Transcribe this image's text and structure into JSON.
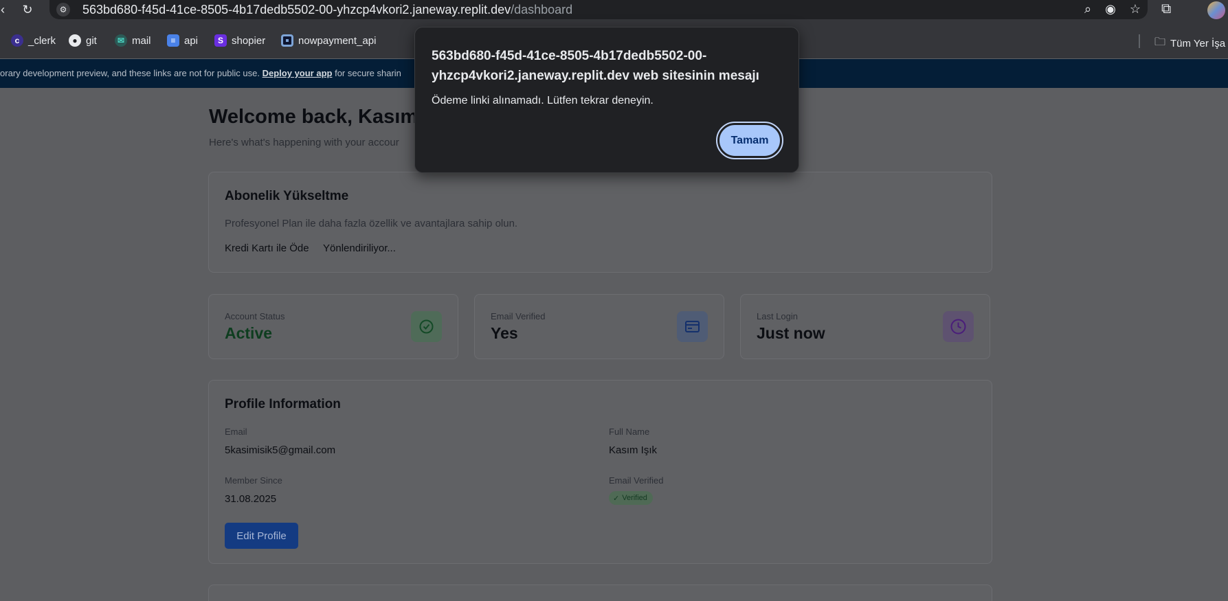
{
  "browser": {
    "url_host": "563bd680-f45d-41ce-8505-4b17dedb5502-00-yhzcp4vkori2.janeway.replit.dev",
    "url_path": "/dashboard",
    "bookmarks": [
      "_clerk",
      "git",
      "mail",
      "api",
      "shopier",
      "nowpayment_api"
    ],
    "all_bookmarks_label": "Tüm Yer İşa"
  },
  "banner": {
    "text_before": "mporary development preview, and these links are not for public use. ",
    "deploy_link": "Deploy your app",
    "text_after": " for secure sharin"
  },
  "dashboard": {
    "welcome": "Welcome back, Kasım",
    "subtitle": "Here's what's happening with your accour"
  },
  "upgrade": {
    "title": "Abonelik Yükseltme",
    "description": "Profesyonel Plan ile daha fazla özellik ve avantajlara sahip olun.",
    "pay_label": "Kredi Kartı ile Öde",
    "status": "Yönlendiriliyor..."
  },
  "stats": [
    {
      "label": "Account Status",
      "value": "Active",
      "icon": "check-circle-icon",
      "value_color": "#0e3d1f",
      "icon_bg": "#4f6b58",
      "icon_color": "#144a27"
    },
    {
      "label": "Email Verified",
      "value": "Yes",
      "icon": "credit-card-icon",
      "value_color": "#0c0e13",
      "icon_bg": "#4f5c75",
      "icon_color": "#14306c"
    },
    {
      "label": "Last Login",
      "value": "Just now",
      "icon": "clock-icon",
      "value_color": "#0c0e13",
      "icon_bg": "#5e5270",
      "icon_color": "#4a1d7a"
    }
  ],
  "profile": {
    "title": "Profile Information",
    "email_label": "Email",
    "email": "5kasimisik5@gmail.com",
    "full_name_label": "Full Name",
    "full_name": "Kasım Işık",
    "member_since_label": "Member Since",
    "member_since": "31.08.2025",
    "email_verified_label": "Email Verified",
    "verified_badge": "Verified",
    "edit_button": "Edit Profile"
  },
  "dialog": {
    "title": "563bd680-f45d-41ce-8505-4b17dedb5502-00-yhzcp4vkori2.janeway.replit.dev web sitesinin mesajı",
    "message": "Ödeme linki alınamadı. Lütfen tekrar deneyin.",
    "ok_button": "Tamam"
  }
}
